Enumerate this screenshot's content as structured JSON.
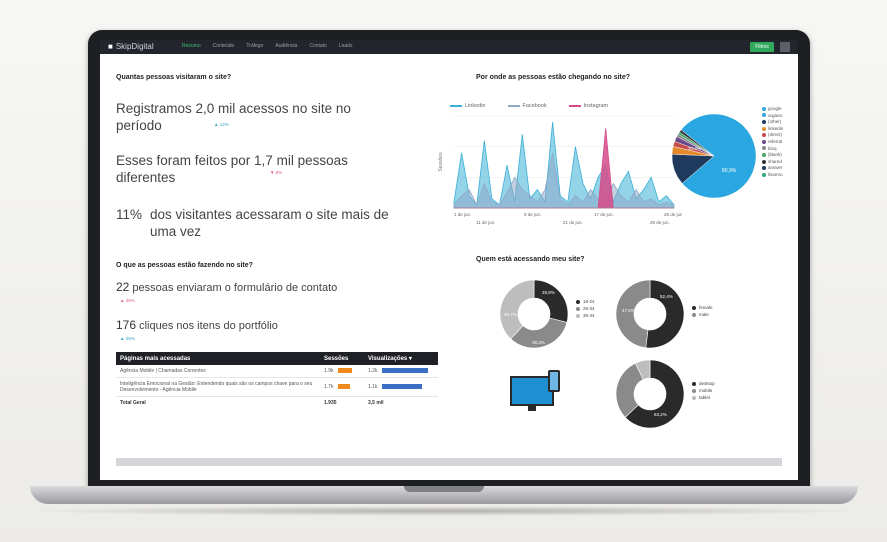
{
  "brand": {
    "name": "SkipDigital"
  },
  "nav": {
    "tabs": [
      "Resumo",
      "Conteúdo",
      "Tráfego",
      "Audiência",
      "Contato",
      "Leads"
    ],
    "button": "Filtros"
  },
  "visits": {
    "title": "Quantas pessoas visitaram o site?",
    "line1": "Registramos 2,0 mil acessos no site no período",
    "delta1": "▲ 12%",
    "line2": "Esses foram feitos por 1,7 mil pessoas diferentes",
    "delta2": "▼ 8%",
    "returning_pct": "11%",
    "returning_text": "dos visitantes acessaram o site mais de uma vez"
  },
  "actions": {
    "title": "O que as pessoas estão fazendo no site?",
    "form_count": "22",
    "form_text": "pessoas enviaram o formulário de contato",
    "form_delta": "▲ 45%",
    "clicks_count": "176",
    "clicks_text": "cliques nos itens do portfólio",
    "clicks_delta": "▲ 25%"
  },
  "pages_table": {
    "headers": [
      "Páginas mais acessadas",
      "Sessões",
      "Visualizações ▾"
    ],
    "rows": [
      {
        "page": "Agência Mobile | Chamadas Correntes",
        "sessions": "1.9k",
        "views": "1.2k"
      },
      {
        "page": "Inteligência Emocional na Gestão: Entendendo quais são os campos chave para o seu Desenvolvimento - Agência Mobile",
        "sessions": "1.7k",
        "views": "1.1k"
      }
    ],
    "total_label": "Total Geral",
    "total_sessions": "1.935",
    "total_views": "3,5 mil"
  },
  "traffic": {
    "title": "Por onde as pessoas estão chegando no site?",
    "legend": [
      "Linkedin",
      "Facebook",
      "Instagram"
    ],
    "colors": {
      "linkedin": "#3ab0d6",
      "facebook": "#8fa8c8",
      "instagram": "#d64a8a"
    },
    "ylabel": "Sessões",
    "x_ticks_top": [
      "1 de jun.",
      "9 de jun.",
      "17 de jun.",
      "25 de jun."
    ],
    "x_ticks_bottom": [
      "11 de jun.",
      "21 de jun.",
      "29 de jun."
    ],
    "pie_labels": [
      "80,9%",
      "20,3%"
    ],
    "pie_legend": [
      "google",
      "organic",
      "(other)",
      "linkedin",
      "(direct)",
      "referral",
      "binq",
      "(blank)",
      "shared",
      "answer",
      "lisarmo"
    ]
  },
  "audience": {
    "title": "Quem está acessando meu site?",
    "donut1": {
      "legend": [
        "18-24",
        "25-34",
        "35-44"
      ],
      "labels": [
        "28,8%",
        "40,7%",
        "38,3%"
      ]
    },
    "donut2": {
      "legend": [
        "female",
        "male"
      ],
      "labels": [
        "52,4%",
        "47,6%"
      ]
    },
    "donut3": {
      "legend": [
        "desktop",
        "mobile",
        "tablet"
      ],
      "labels": [
        "63,2%"
      ]
    }
  },
  "chart_data": {
    "type": "area",
    "series": [
      {
        "name": "Linkedin",
        "values": [
          2,
          18,
          4,
          1,
          22,
          3,
          1,
          14,
          2,
          24,
          3,
          6,
          2,
          28,
          4,
          2,
          20,
          8,
          3,
          10,
          14,
          2,
          8,
          12,
          3,
          6,
          10,
          2,
          4,
          1
        ]
      },
      {
        "name": "Facebook",
        "values": [
          1,
          4,
          6,
          1,
          8,
          2,
          1,
          5,
          10,
          6,
          4,
          2,
          6,
          18,
          3,
          1,
          4,
          2,
          6,
          3,
          2,
          8,
          4,
          2,
          6,
          2,
          3,
          1,
          2,
          1
        ]
      },
      {
        "name": "Instagram",
        "values": [
          0,
          0,
          0,
          0,
          0,
          0,
          0,
          0,
          0,
          0,
          0,
          0,
          0,
          0,
          0,
          0,
          0,
          0,
          0,
          0,
          26,
          0,
          0,
          0,
          0,
          0,
          0,
          0,
          0,
          0
        ]
      }
    ],
    "xlabel": "",
    "ylabel": "Sessões",
    "grid": true,
    "legend": "top"
  }
}
